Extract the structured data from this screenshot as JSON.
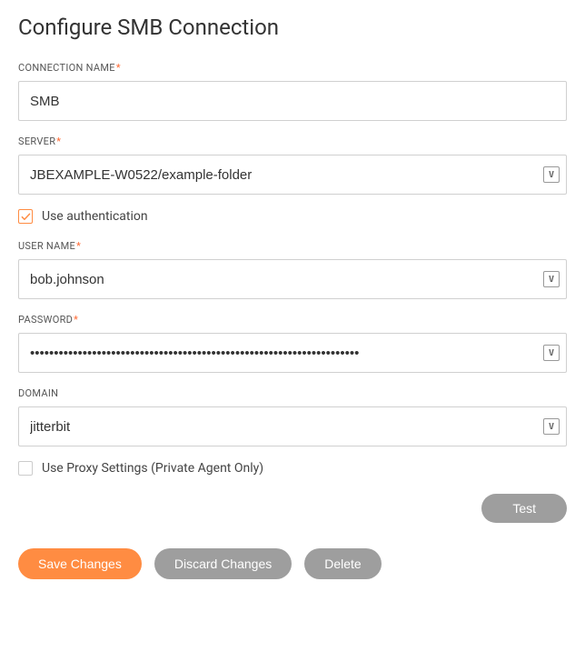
{
  "title": "Configure SMB Connection",
  "fields": {
    "connectionName": {
      "label": "CONNECTION NAME",
      "required": "*",
      "value": "SMB"
    },
    "server": {
      "label": "SERVER",
      "required": "*",
      "value": "JBEXAMPLE-W0522/example-folder"
    },
    "useAuth": {
      "label": "Use authentication",
      "checked": true
    },
    "userName": {
      "label": "USER NAME",
      "required": "*",
      "value": "bob.johnson"
    },
    "password": {
      "label": "PASSWORD",
      "required": "*",
      "value": "•••••••••••••••••••••••••••••••••••••••••••••••••••••••••••••••••••••"
    },
    "domain": {
      "label": "DOMAIN",
      "value": "jitterbit"
    },
    "useProxy": {
      "label": "Use Proxy Settings (Private Agent Only)",
      "checked": false
    }
  },
  "buttons": {
    "test": "Test",
    "save": "Save Changes",
    "discard": "Discard Changes",
    "delete": "Delete"
  },
  "iconGlyph": "V"
}
